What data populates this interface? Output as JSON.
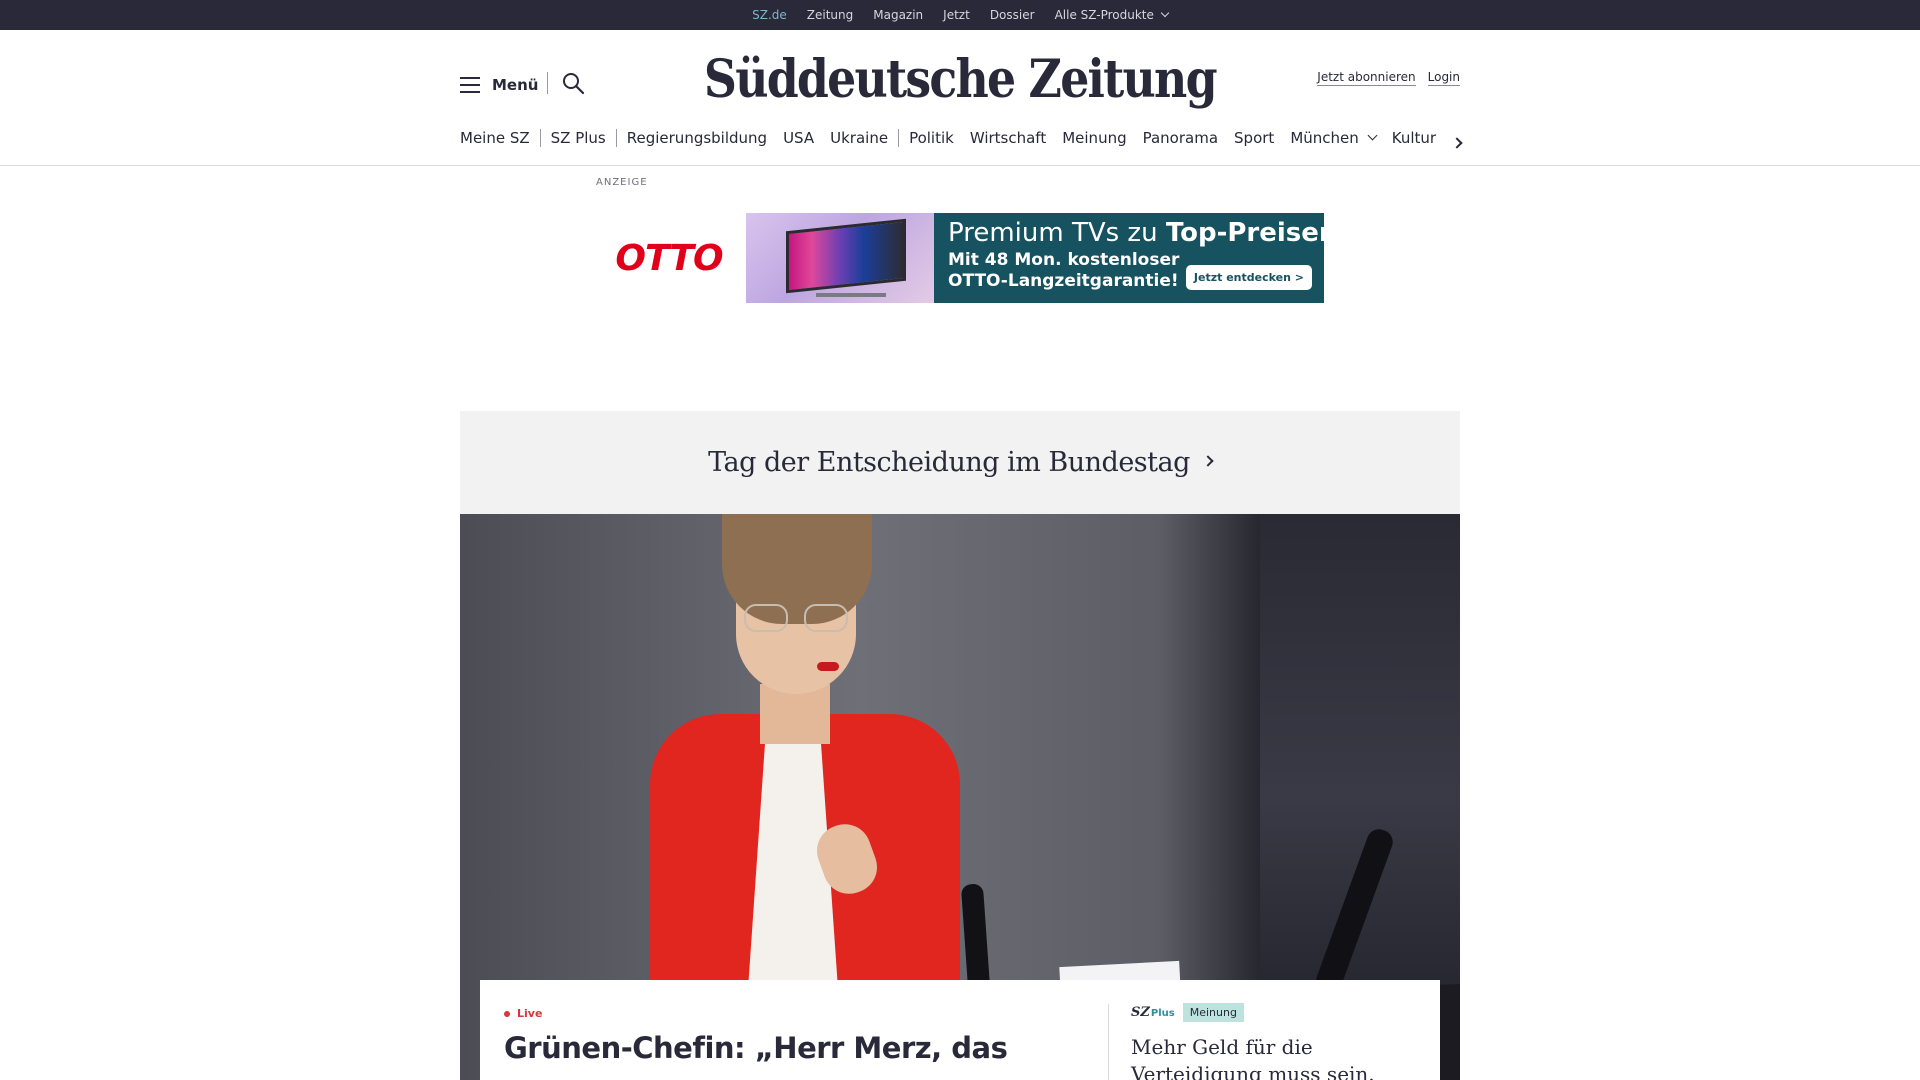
{
  "topbar": {
    "links": [
      "SZ.de",
      "Zeitung",
      "Magazin",
      "Jetzt",
      "Dossier",
      "Alle SZ-Produkte"
    ],
    "active": "SZ.de"
  },
  "header": {
    "logo": "Süddeutsche Zeitung",
    "menu_label": "Menü",
    "subscribe_label": "Jetzt abonnieren",
    "login_label": "Login"
  },
  "nav": {
    "items": [
      "Meine SZ",
      "SZ Plus",
      "Regierungsbildung",
      "USA",
      "Ukraine",
      "Politik",
      "Wirtschaft",
      "Meinung",
      "Panorama",
      "Sport",
      "München",
      "Kultur"
    ]
  },
  "ad": {
    "label": "ANZEIGE",
    "brand": "OTTO",
    "headline_part1": "Premium TVs zu ",
    "headline_part2": "Top-Preisen.",
    "subline": "Mit 48 Mon. kostenloser OTTO-Langzeitgarantie!",
    "cta": "Jetzt entdecken >"
  },
  "topic": {
    "title": "Tag der Entscheidung im Bundestag"
  },
  "lead_article": {
    "badge": "Live",
    "headline": "Grünen-Chefin: „Herr Merz, das"
  },
  "side_article": {
    "brand": "SZ",
    "brand_suffix": "Plus",
    "tag": "Meinung",
    "title": "Mehr Geld für die Verteidigung muss sein."
  },
  "colors": {
    "topbar_bg": "#29293a",
    "active_link": "#7fb6c9",
    "live_red": "#d9363e",
    "otto_red": "#e1001a",
    "ad_teal": "#16525f",
    "tag_bg": "#bde3df"
  }
}
